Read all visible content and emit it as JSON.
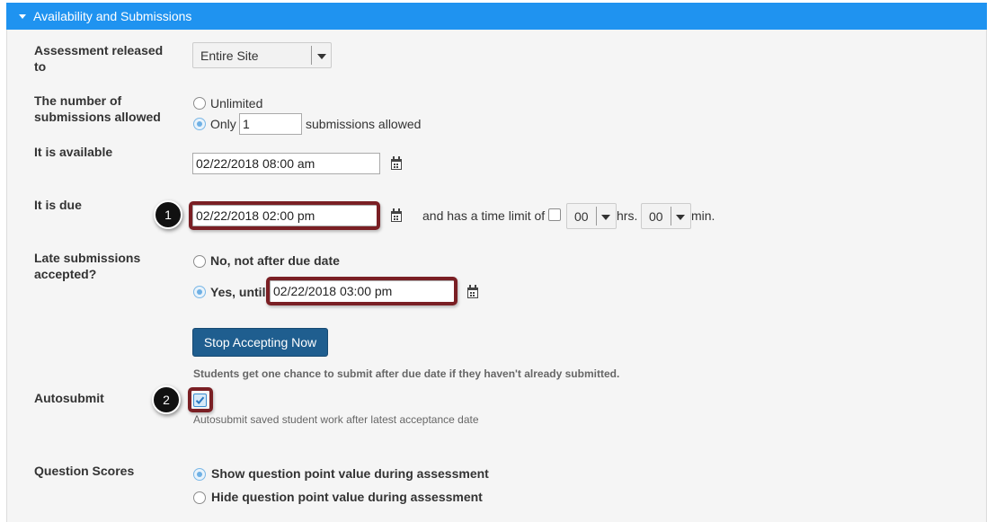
{
  "panel": {
    "title": "Availability and Submissions",
    "collapse_icon": "caret-down-icon"
  },
  "released_to": {
    "label": "Assessment released to",
    "selected": "Entire Site"
  },
  "submissions": {
    "label": "The number of submissions allowed",
    "unlimited_label": "Unlimited",
    "only_label": "Only",
    "only_value": "1",
    "suffix": "submissions allowed",
    "selected": "only"
  },
  "available": {
    "label": "It is available",
    "value": "02/22/2018 08:00 am",
    "icon": "calendar-icon"
  },
  "due": {
    "label": "It is due",
    "value": "02/22/2018 02:00 pm",
    "icon": "calendar-icon",
    "time_limit_label": "and has a time limit of",
    "hours_value": "00",
    "hours_unit": "hrs.",
    "minutes_value": "00",
    "minutes_unit": "min."
  },
  "late": {
    "label": "Late submissions accepted?",
    "no_label": "No, not after due date",
    "yes_label": "Yes, until",
    "until_value": "02/22/2018 03:00 pm",
    "selected": "yes",
    "button_label": "Stop Accepting Now",
    "help": "Students get one chance to submit after due date if they haven't already submitted."
  },
  "autosubmit": {
    "label": "Autosubmit",
    "checked": true,
    "help": "Autosubmit saved student work after latest acceptance date"
  },
  "scores": {
    "label": "Question Scores",
    "show_label": "Show question point value during assessment",
    "hide_label": "Hide question point value during assessment",
    "selected": "show"
  },
  "callouts": {
    "first": "1",
    "second": "2"
  },
  "colors": {
    "header": "#1f93f0",
    "highlight": "#7a1f24",
    "button": "#1f5e8f",
    "panel_bg": "#f5f5f5"
  }
}
